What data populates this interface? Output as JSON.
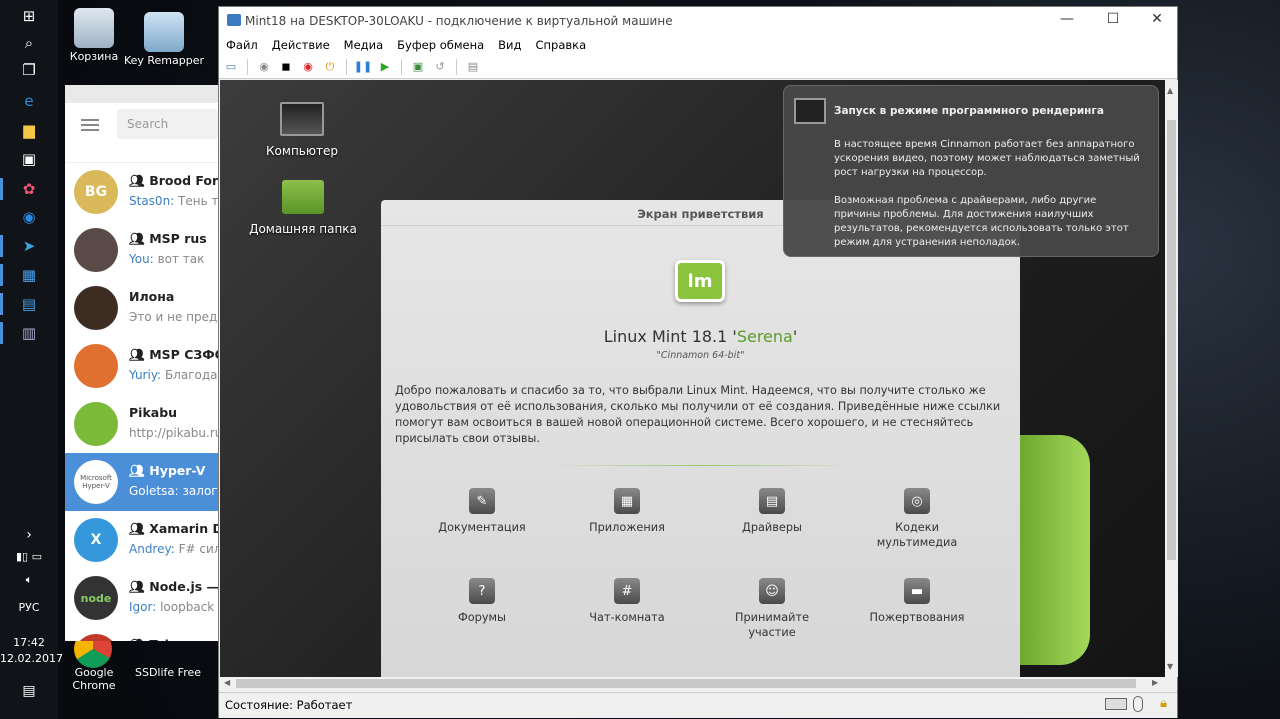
{
  "desktop": {
    "icons": [
      {
        "label": "Корзина"
      },
      {
        "label": "Key Remapper"
      },
      {
        "label": "Google Chrome"
      },
      {
        "label": "SSDlife Free"
      }
    ],
    "tray": {
      "time": "17:42",
      "date": "12.02.2017",
      "lang": "РУС"
    }
  },
  "telegram": {
    "search_placeholder": "Search",
    "chats": [
      {
        "avatar": "BG",
        "name": "Brood Force",
        "who": "Stas0n:",
        "msg": "Тень так",
        "group": true,
        "color": "#d9b95a"
      },
      {
        "avatar": "",
        "name": "MSP rus",
        "who": "You:",
        "msg": "вот так",
        "group": true,
        "color": "#5a4a48"
      },
      {
        "avatar": "",
        "name": "Илона",
        "who": "",
        "msg": "Это и не предло",
        "group": false,
        "color": "#3c2c22"
      },
      {
        "avatar": "",
        "name": "MSP СЗФО",
        "who": "Yuriy:",
        "msg": "Благодар",
        "group": true,
        "color": "#e07030"
      },
      {
        "avatar": "",
        "name": "Pikabu",
        "who": "",
        "msg": "http://pikabu.ru",
        "group": false,
        "color": "#7cba3a"
      },
      {
        "avatar": "Microsoft Hyper-V",
        "name": "Hyper-V",
        "who": "Goletsa:",
        "msg": "залоги",
        "group": true,
        "color": "#ffffff"
      },
      {
        "avatar": "X",
        "name": "Xamarin De",
        "who": "Andrey:",
        "msg": "F# силь",
        "group": true,
        "color": "#3498db"
      },
      {
        "avatar": "node",
        "name": "Node.js — р",
        "who": "Igor:",
        "msg": "loopback",
        "group": true,
        "color": "#333333"
      },
      {
        "avatar": "",
        "name": "Telegram In",
        "who": "",
        "msg": "",
        "group": true,
        "color": "#c0392b"
      }
    ]
  },
  "window": {
    "title": "Mint18 на DESKTOP-30LOAKU - подключение к виртуальной машине",
    "menu": [
      "Файл",
      "Действие",
      "Медиа",
      "Буфер обмена",
      "Вид",
      "Справка"
    ],
    "status": "Состояние: Работает"
  },
  "vm": {
    "icons": [
      {
        "label": "Компьютер"
      },
      {
        "label": "Домашняя папка"
      }
    ],
    "welcome": {
      "title": "Экран приветствия",
      "version_prefix": "Linux Mint 18.1 '",
      "version_name": "Serena",
      "version_suffix": "'",
      "edition": "\"Cinnamon 64-bit\"",
      "intro": "Добро пожаловать и спасибо за то, что выбрали Linux Mint. Надеемся, что вы получите столько же удовольствия от её использования, сколько мы получили от её создания. Приведённые ниже ссылки помогут вам освоиться в вашей новой операционной системе. Всего хорошего, и не стесняйтесь присылать свои отзывы.",
      "items": [
        "Документация",
        "Приложения",
        "Драйверы",
        "Кодеки мультимедиа",
        "Форумы",
        "Чат-комната",
        "Принимайте участие",
        "Пожертвования"
      ]
    },
    "notification": {
      "title": "Запуск в режиме программного рендеринга",
      "p1": "В настоящее время Cinnamon работает без аппаратного ускорения видео, поэтому может наблюдаться заметный рост нагрузки на процессор.",
      "p2": "Возможная проблема с драйверами, либо другие причины проблемы. Для достижения наилучших результатов, рекомендуется использовать только этот режим для устранения неполадок."
    }
  }
}
